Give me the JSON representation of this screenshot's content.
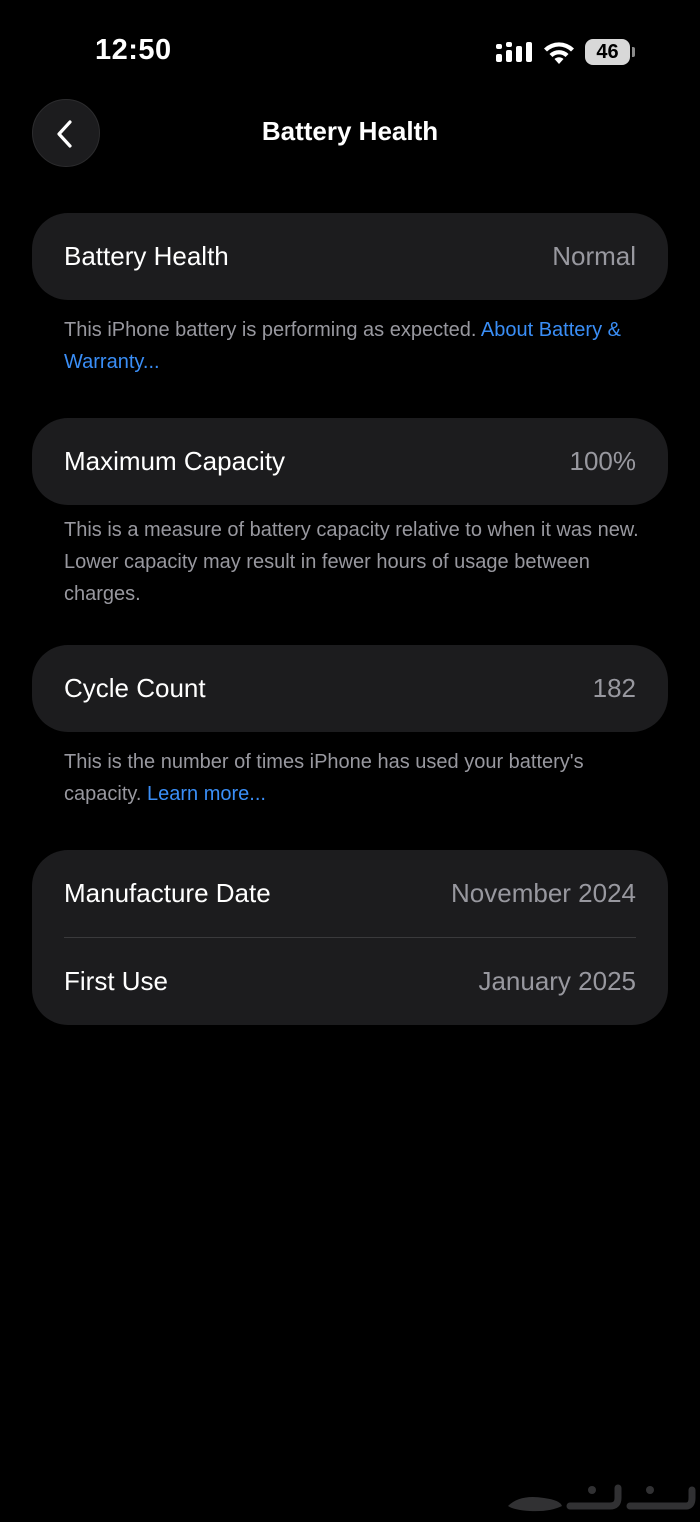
{
  "status_bar": {
    "time": "12:50",
    "battery_level": "46",
    "signal_icon": "cellular-signal-icon",
    "wifi_icon": "wifi-icon",
    "battery_icon": "battery-icon"
  },
  "nav": {
    "title": "Battery Health",
    "back_icon": "chevron-left-icon"
  },
  "battery_health": {
    "label": "Battery Health",
    "value": "Normal",
    "footnote": "This iPhone battery is performing as expected. ",
    "footnote_link": "About Battery & Warranty..."
  },
  "maximum_capacity": {
    "label": "Maximum Capacity",
    "value": "100%",
    "footnote": "This is a measure of battery capacity relative to when it was new. Lower capacity may result in fewer hours of usage between charges."
  },
  "cycle_count": {
    "label": "Cycle Count",
    "value": "182",
    "footnote": "This is the number of times iPhone has used your battery's capacity. ",
    "footnote_link": "Learn more..."
  },
  "dates": {
    "manufacture_label": "Manufacture Date",
    "manufacture_value": "November 2024",
    "first_use_label": "First Use",
    "first_use_value": "January 2025"
  },
  "colors": {
    "background": "#000000",
    "card": "#1c1c1e",
    "secondary_text": "#98989f",
    "link": "#3a8ef6"
  }
}
